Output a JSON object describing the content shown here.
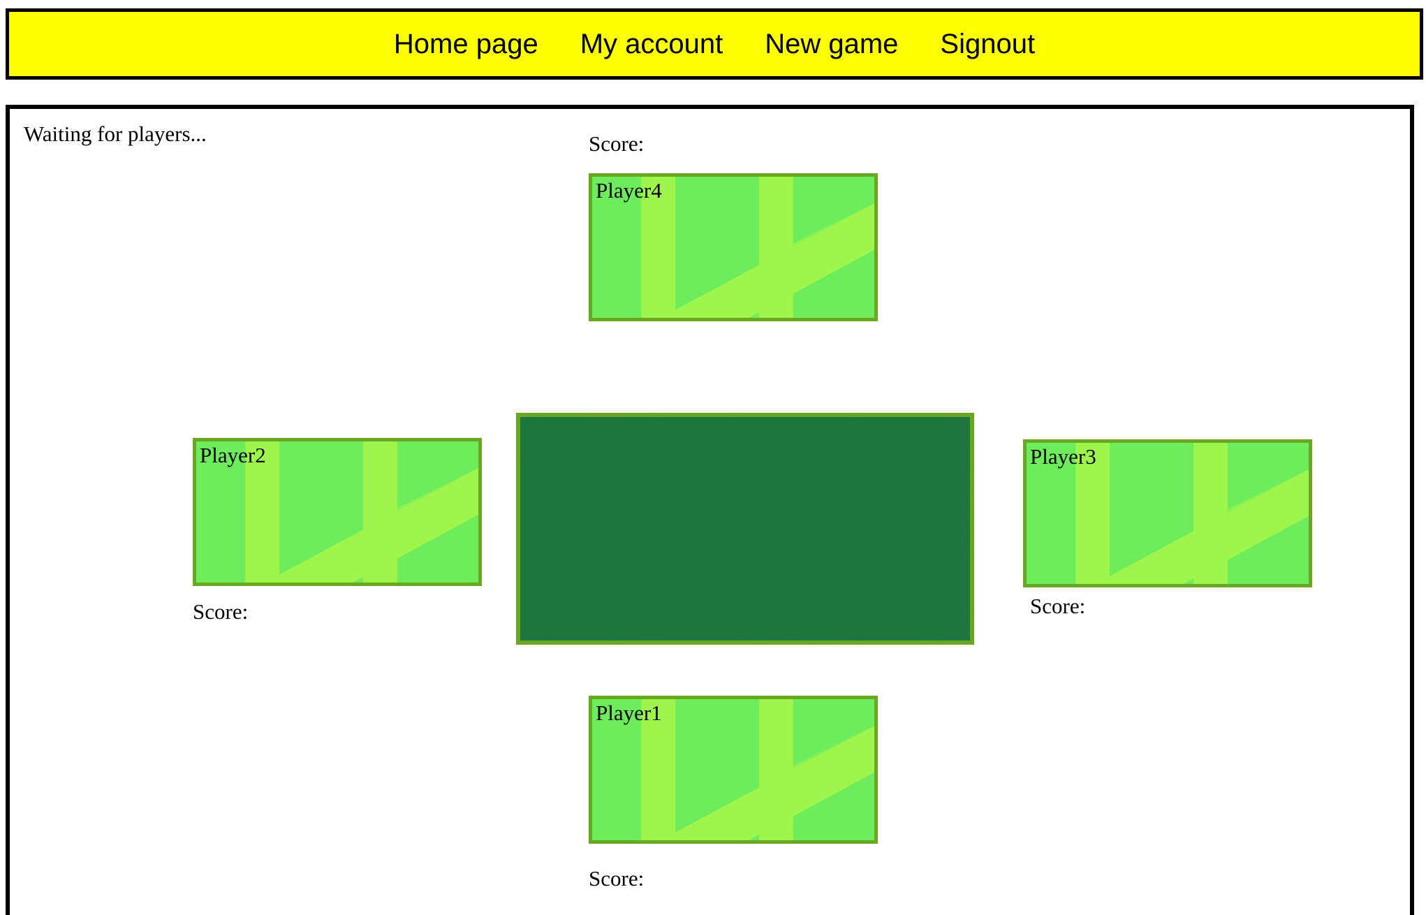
{
  "nav": {
    "items": [
      "Home page",
      "My account",
      "New game",
      "Signout"
    ]
  },
  "status": "Waiting for players...",
  "players": {
    "player1": {
      "name": "Player1",
      "score_label": "Score:"
    },
    "player2": {
      "name": "Player2",
      "score_label": "Score:"
    },
    "player3": {
      "name": "Player3",
      "score_label": "Score:"
    },
    "player4": {
      "name": "Player4",
      "score_label": "Score:"
    }
  },
  "colors": {
    "nav_bg": "#ffff00",
    "hand_bg": "#6ded5c",
    "hand_stripe": "#9ef54b",
    "hand_border": "#6aa824",
    "table_felt": "#166d35"
  }
}
